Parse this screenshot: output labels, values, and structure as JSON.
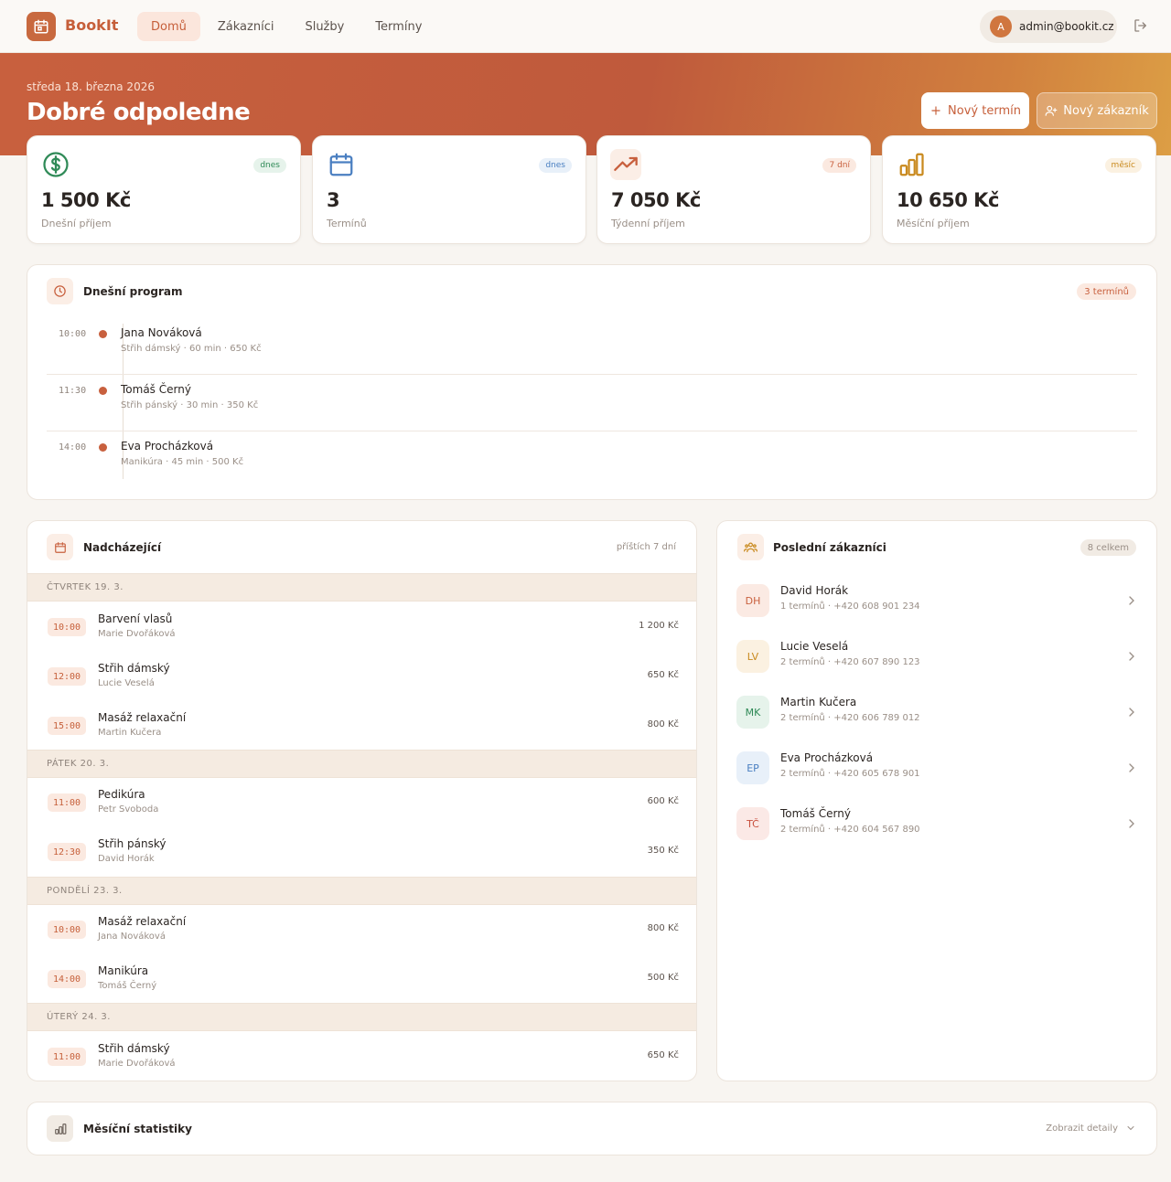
{
  "nav": {
    "brand": "BookIt",
    "links": [
      "Domů",
      "Zákazníci",
      "Služby",
      "Termíny"
    ],
    "active": "Domů",
    "user_initial": "A",
    "user_email": "admin@bookit.cz"
  },
  "hero": {
    "date": "středa 18. března 2026",
    "greeting": "Dobré odpoledne",
    "new_appointment_label": "Nový termín",
    "new_customer_label": "Nový zákazník"
  },
  "stats": [
    {
      "value": "1 500 Kč",
      "label": "Dnešní příjem",
      "badge": "dnes",
      "icon": "dollar-icon",
      "color": "#2f8a57"
    },
    {
      "value": "3",
      "label": "Termínů",
      "badge": "dnes",
      "icon": "calendar-icon",
      "color": "#4a7fc1"
    },
    {
      "value": "7 050 Kč",
      "label": "Týdenní příjem",
      "badge": "7 dní",
      "icon": "trending-up-icon",
      "color": "#c8603e"
    },
    {
      "value": "10 650 Kč",
      "label": "Měsíční příjem",
      "badge": "měsíc",
      "icon": "bar-chart-icon",
      "color": "#c98a1f"
    }
  ],
  "today": {
    "title": "Dnešní program",
    "count": "3 termínů",
    "items": [
      {
        "time": "10:00",
        "name": "Jana Nováková",
        "detail": "Střih dámský · 60 min · 650 Kč"
      },
      {
        "time": "11:30",
        "name": "Tomáš Černý",
        "detail": "Střih pánský · 30 min · 350 Kč"
      },
      {
        "time": "14:00",
        "name": "Eva Procházková",
        "detail": "Manikúra · 45 min · 500 Kč"
      }
    ]
  },
  "upcoming": {
    "title": "Nadcházející",
    "range": "příštích 7 dní",
    "days": [
      {
        "label": "ČTVRTEK 19. 3.",
        "items": [
          {
            "time": "10:00",
            "service": "Barvení vlasů",
            "customer": "Marie Dvořáková",
            "price": "1 200 Kč"
          },
          {
            "time": "12:00",
            "service": "Střih dámský",
            "customer": "Lucie Veselá",
            "price": "650 Kč"
          },
          {
            "time": "15:00",
            "service": "Masáž relaxační",
            "customer": "Martin Kučera",
            "price": "800 Kč"
          }
        ]
      },
      {
        "label": "PÁTEK 20. 3.",
        "items": [
          {
            "time": "11:00",
            "service": "Pedikúra",
            "customer": "Petr Svoboda",
            "price": "600 Kč"
          },
          {
            "time": "12:30",
            "service": "Střih pánský",
            "customer": "David Horák",
            "price": "350 Kč"
          }
        ]
      },
      {
        "label": "PONDĚLÍ 23. 3.",
        "items": [
          {
            "time": "10:00",
            "service": "Masáž relaxační",
            "customer": "Jana Nováková",
            "price": "800 Kč"
          },
          {
            "time": "14:00",
            "service": "Manikúra",
            "customer": "Tomáš Černý",
            "price": "500 Kč"
          }
        ]
      },
      {
        "label": "ÚTERÝ 24. 3.",
        "items": [
          {
            "time": "11:00",
            "service": "Střih dámský",
            "customer": "Marie Dvořáková",
            "price": "650 Kč"
          }
        ]
      }
    ]
  },
  "customers": {
    "title": "Poslední zákazníci",
    "count": "8 celkem",
    "items": [
      {
        "initials": "DH",
        "name": "David Horák",
        "detail": "1 termínů · +420 608 901 234",
        "bg": "#fbeae3",
        "fg": "#c8603e"
      },
      {
        "initials": "LV",
        "name": "Lucie Veselá",
        "detail": "2 termínů · +420 607 890 123",
        "bg": "#fbf1e1",
        "fg": "#c98a1f"
      },
      {
        "initials": "MK",
        "name": "Martin Kučera",
        "detail": "2 termínů · +420 606 789 012",
        "bg": "#e6f3eb",
        "fg": "#2f8a57"
      },
      {
        "initials": "EP",
        "name": "Eva Procházková",
        "detail": "2 termínů · +420 605 678 901",
        "bg": "#e8f0f9",
        "fg": "#4a7fc1"
      },
      {
        "initials": "TČ",
        "name": "Tomáš Černý",
        "detail": "2 termínů · +420 604 567 890",
        "bg": "#fbe9e6",
        "fg": "#c8503e"
      }
    ]
  },
  "monthly": {
    "title": "Měsíční statistiky",
    "details_label": "Zobrazit detaily"
  }
}
